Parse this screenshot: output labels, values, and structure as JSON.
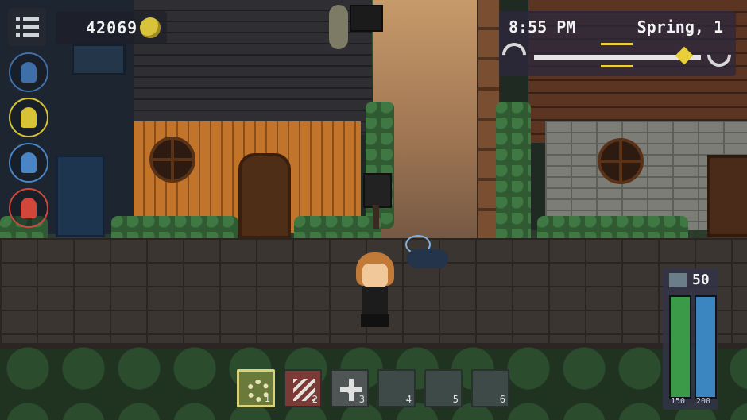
{
  "hud": {
    "gold": "42069",
    "time": "8:55 PM",
    "season": "Spring, 1",
    "day_progress": 0.9,
    "level": "50",
    "health": {
      "current": 150,
      "max": 150,
      "label": "150",
      "color": "#3a9a48"
    },
    "energy": {
      "current": 200,
      "max": 200,
      "label": "200",
      "color": "#3b86c0"
    },
    "sun_color": "#e9cf3a"
  },
  "side_icons": [
    {
      "name": "blue-spirit-icon",
      "color": "#3f6fa8"
    },
    {
      "name": "yellow-spirit-icon",
      "color": "#d8c235"
    },
    {
      "name": "blue-owl-spirit-icon",
      "color": "#4a86c6"
    },
    {
      "name": "red-spirit-icon",
      "color": "#d2473a"
    }
  ],
  "hotbar": [
    {
      "slot": "1",
      "icon": "settings-gear-icon",
      "bg": "#6a7a3a",
      "selected": true
    },
    {
      "slot": "2",
      "icon": "slash-attack-icon",
      "bg": "#7a3a36",
      "selected": false
    },
    {
      "slot": "3",
      "icon": "dpad-move-icon",
      "bg": "#4f5455",
      "selected": false
    },
    {
      "slot": "4",
      "icon": "",
      "bg": "#3e4a47",
      "selected": false
    },
    {
      "slot": "5",
      "icon": "",
      "bg": "#3e4a47",
      "selected": false
    },
    {
      "slot": "6",
      "icon": "",
      "bg": "#3e4a47",
      "selected": false
    }
  ]
}
